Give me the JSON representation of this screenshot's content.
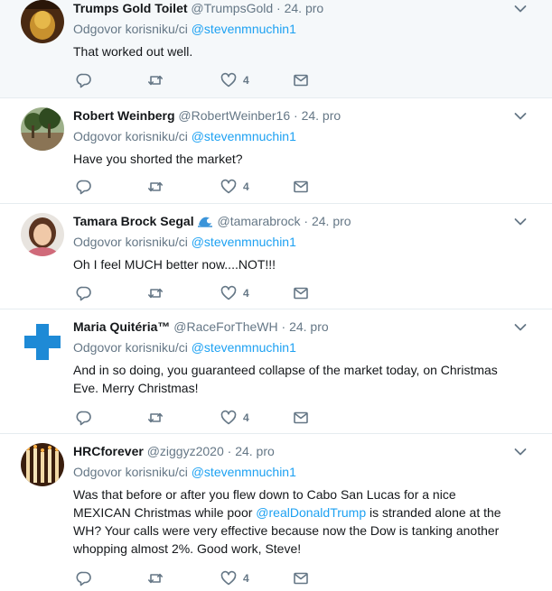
{
  "reply_prefix": "Odgovor korisniku/ci",
  "reply_to": "@stevenmnuchin1",
  "separator": "·",
  "colors": {
    "link": "#1da1f2",
    "secondary": "#657786",
    "divider": "#e6ecf0",
    "highlight_bg": "#f5f8fa"
  },
  "icons": {
    "reply": "reply-icon",
    "retweet": "retweet-icon",
    "like": "heart-icon",
    "dm": "envelope-icon",
    "more": "chevron-down-icon"
  },
  "tweets": [
    {
      "name": "Trumps Gold Toilet",
      "handle": "@TrumpsGold",
      "date": "24. pro",
      "text": "That worked out well.",
      "likes": "4"
    },
    {
      "name": "Robert Weinberg",
      "handle": "@RobertWeinber16",
      "date": "24. pro",
      "text": "Have you shorted the market?",
      "likes": "4"
    },
    {
      "name": "Tamara Brock Segal",
      "handle": "@tamarabrock",
      "date": "24. pro",
      "text": "Oh I feel MUCH better now....NOT!!!",
      "likes": "4"
    },
    {
      "name": "Maria Quitéria™",
      "handle": "@RaceForTheWH",
      "date": "24. pro",
      "text": "And in so doing, you guaranteed collapse of the market today, on Christmas Eve. Merry Christmas!",
      "likes": "4"
    },
    {
      "name": "HRCforever",
      "handle": "@ziggyz2020",
      "date": "24. pro",
      "text_before": "Was that before or after you flew down to Cabo San Lucas for a nice MEXICAN Christmas while poor ",
      "text_mention": "@realDonaldTrump",
      "text_after": " is stranded alone at the WH? Your calls were very effective because now the Dow is tanking another whopping almost 2%. Good work, Steve!",
      "likes": "4"
    }
  ]
}
